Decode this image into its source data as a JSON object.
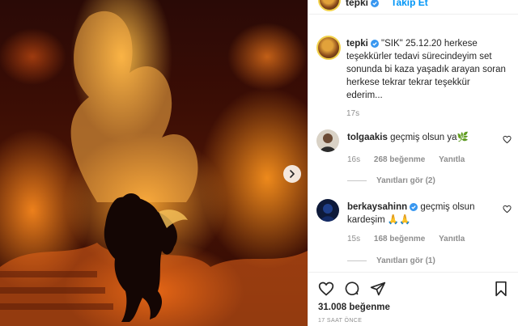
{
  "post": {
    "username": "tepki",
    "follow_label": "Takip Et",
    "caption_username": "tepki",
    "caption_text": "\"SIK\" 25.12.20 herkese teşekkürler tedavi sürecindeyim set sonunda bi kaza yaşadık arayan soran herkese tekrar tekrar teşekkür ederim...",
    "caption_time": "17s"
  },
  "comments": [
    {
      "username": "tolgaakis",
      "text": "geçmiş olsun ya🌿",
      "time": "16s",
      "likes": "268 beğenme",
      "reply": "Yanıtla",
      "view_replies": "Yanıtları gör (2)"
    },
    {
      "username": "berkaysahinn",
      "text": "geçmiş olsun kardeşim 🙏🙏",
      "time": "15s",
      "likes": "168 beğenme",
      "reply": "Yanıtla",
      "view_replies": "Yanıtları gör (1)"
    }
  ],
  "footer": {
    "likes_count": "31.008 beğenme",
    "time_ago": "17 SAAT ÖNCE"
  },
  "colors": {
    "link_blue": "#0095f6",
    "verified_blue": "#3897f0",
    "secondary_text": "#8e8e8e"
  },
  "icons": {
    "heart": "heart-icon",
    "comment": "comment-icon",
    "share": "share-icon",
    "bookmark": "bookmark-icon",
    "next": "chevron-right-icon",
    "verified": "verified-badge-icon"
  }
}
